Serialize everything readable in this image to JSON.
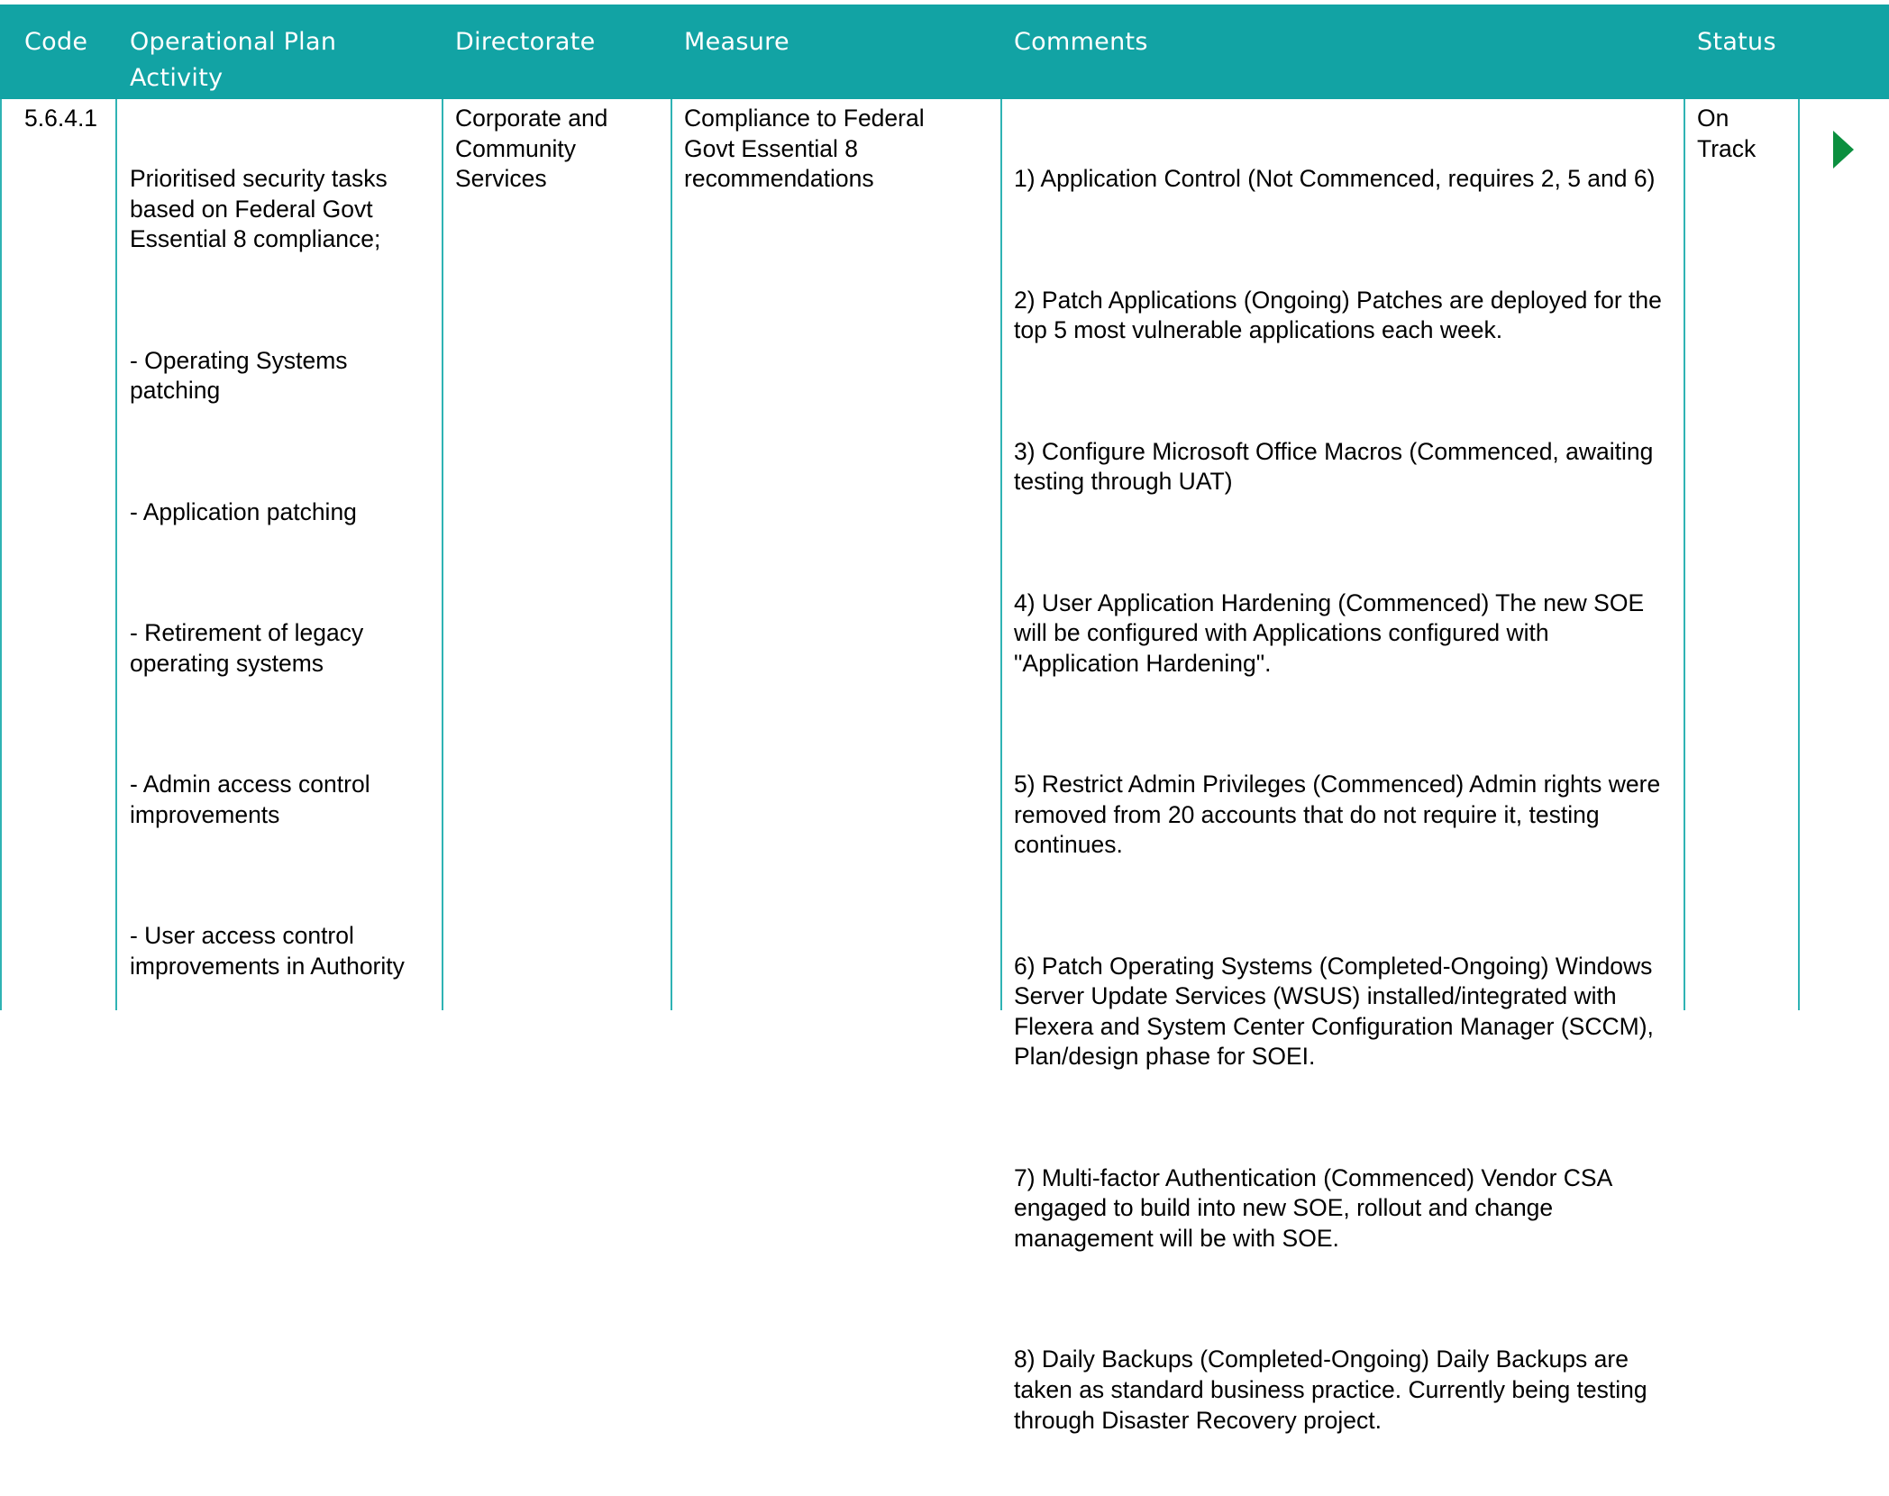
{
  "table": {
    "headers": {
      "code": "Code",
      "activity": "Operational Plan Activity",
      "directorate": "Directorate",
      "measure": "Measure",
      "comments": "Comments",
      "status": "Status"
    },
    "row": {
      "code": "5.6.4.1",
      "activity": [
        "Prioritised security tasks based on Federal Govt Essential 8 compliance;",
        "- Operating Systems patching",
        "- Application patching",
        "- Retirement of legacy operating systems",
        "- Admin access control improvements",
        "- User access control improvements in Authority"
      ],
      "directorate": "Corporate and Community Services",
      "measure": "Compliance to Federal Govt Essential 8 recommendations",
      "comments": [
        "1) Application Control (Not Commenced, requires 2, 5 and 6)",
        "2) Patch Applications (Ongoing) Patches are deployed for the top 5 most vulnerable applications each week.",
        "3) Configure Microsoft Office Macros (Commenced, awaiting testing through UAT)",
        "4) User Application Hardening (Commenced) The new SOE will be configured with Applications configured with \"Application Hardening\".",
        "5) Restrict Admin Privileges (Commenced) Admin rights were removed from 20 accounts that do not require it, testing continues.",
        "6) Patch Operating Systems (Completed-Ongoing) Windows Server Update Services (WSUS) installed/integrated with Flexera and System Center Configuration Manager (SCCM), Plan/design phase for SOEI.",
        "7) Multi-factor Authentication (Commenced) Vendor CSA engaged to build into new SOE, rollout and change management will be with SOE.",
        "8) Daily Backups (Completed-Ongoing) Daily Backups are taken as standard business practice. Currently being testing through Disaster Recovery project."
      ],
      "status": "On Track",
      "status_icon": "play-triangle-icon"
    }
  },
  "colors": {
    "header_bg": "#12a3a4",
    "grid_line": "#2fb3b4",
    "status_arrow": "#0b8f3f"
  }
}
